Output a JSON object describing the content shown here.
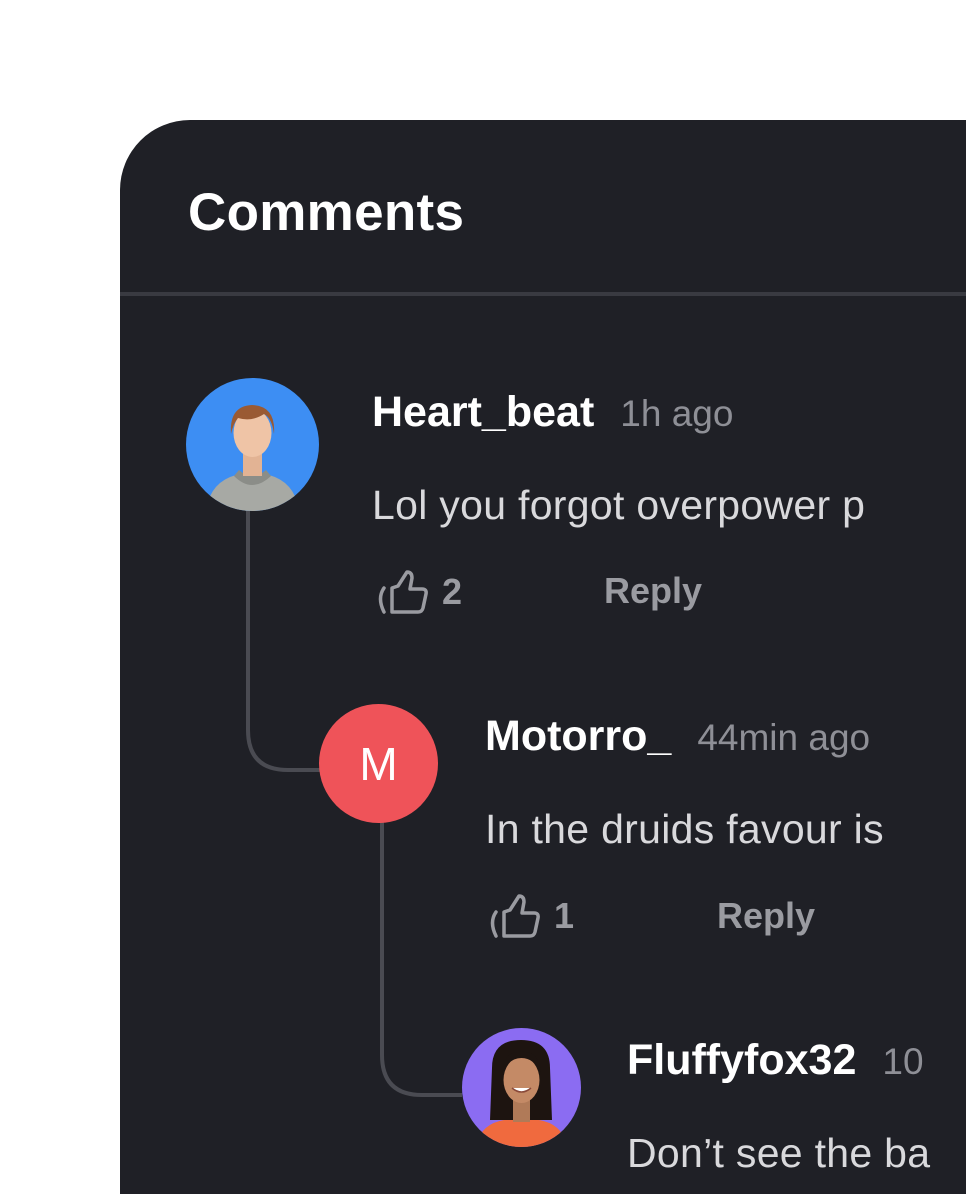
{
  "header": {
    "title": "Comments"
  },
  "comments": [
    {
      "username": "Heart_beat",
      "time": "1h ago",
      "text": "Lol you forgot overpower p",
      "likes": "2",
      "reply_label": "Reply",
      "avatar_bg": "#3d8ef3"
    },
    {
      "username": "Motorro_",
      "time": "44min ago",
      "text": "In the druids favour is",
      "likes": "1",
      "reply_label": "Reply",
      "avatar_letter": "M",
      "avatar_bg": "#ef5359"
    },
    {
      "username": "Fluffyfox32",
      "time": "10",
      "text": "Don’t see the ba",
      "avatar_bg": "#8b6cf2"
    }
  ],
  "colors": {
    "panel_bg": "#1f2026",
    "divider": "#393a41",
    "thread_line": "#4a4b52",
    "muted_text": "#8e8f96"
  },
  "icons": {
    "like": "thumbs-up-icon"
  }
}
